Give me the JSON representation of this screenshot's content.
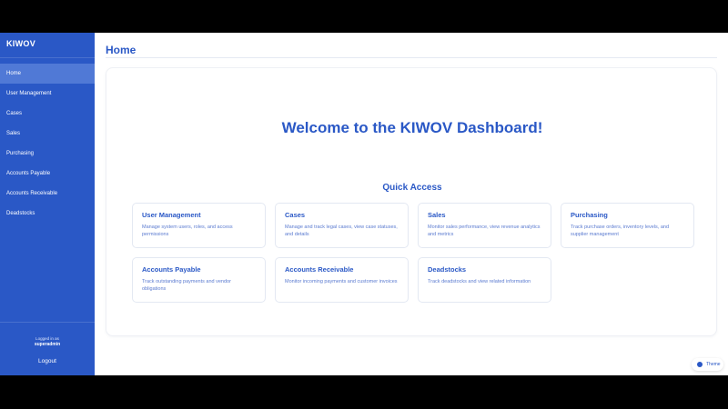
{
  "sidebar": {
    "brand": "KIWOV",
    "items": [
      {
        "label": "Home",
        "active": true
      },
      {
        "label": "User Management"
      },
      {
        "label": "Cases"
      },
      {
        "label": "Sales"
      },
      {
        "label": "Purchasing"
      },
      {
        "label": "Accounts Payable"
      },
      {
        "label": "Accounts Receivable"
      },
      {
        "label": "Deadstocks"
      }
    ],
    "logged_in_label": "Logged in as",
    "username": "superadmin",
    "logout_label": "Logout"
  },
  "main": {
    "page_title": "Home",
    "welcome": "Welcome to the KIWOV Dashboard!",
    "quick_access_title": "Quick Access",
    "tiles": [
      {
        "title": "User Management",
        "desc": "Manage system users, roles, and access permissions"
      },
      {
        "title": "Cases",
        "desc": "Manage and track legal cases, view case statuses, and details"
      },
      {
        "title": "Sales",
        "desc": "Monitor sales performance, view revenue analytics and metrics"
      },
      {
        "title": "Purchasing",
        "desc": "Track purchase orders, inventory levels, and supplier management"
      },
      {
        "title": "Accounts Payable",
        "desc": "Track outstanding payments and vendor obligations"
      },
      {
        "title": "Accounts Receivable",
        "desc": "Monitor incoming payments and customer invoices"
      },
      {
        "title": "Deadstocks",
        "desc": "Track deadstocks and view related information"
      }
    ]
  },
  "theme_toggle": {
    "label": "Theme",
    "icon": "theme-dot-icon"
  },
  "colors": {
    "primary": "#2a58c6",
    "sidebar_active": "#5079d6"
  }
}
